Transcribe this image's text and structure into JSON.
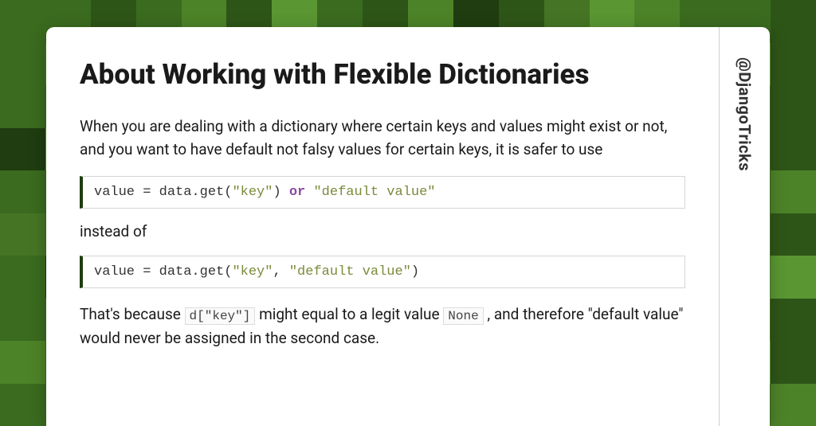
{
  "article": {
    "title": "About Working with Flexible Dictionaries",
    "intro": "When you are dealing with a dictionary where certain keys and values might exist or not, and you want to have default not falsy values for certain keys, it is safer to use",
    "code1": {
      "prefix": "value = data.get(",
      "arg1": "\"key\"",
      "mid": ") ",
      "op": "or",
      "after": " ",
      "arg2": "\"default value\""
    },
    "between": "instead of",
    "code2": {
      "prefix": "value = data.get(",
      "arg1": "\"key\"",
      "mid": ", ",
      "arg2": "\"default value\"",
      "suffix": ")"
    },
    "explain_pre": "That's because ",
    "explain_code1": "d[\"key\"]",
    "explain_mid": " might equal to a legit value ",
    "explain_code2": "None",
    "explain_post": " , and therefore \"default value\" would never be assigned in the second case."
  },
  "sidebar": {
    "handle": "@DjangoTricks"
  }
}
